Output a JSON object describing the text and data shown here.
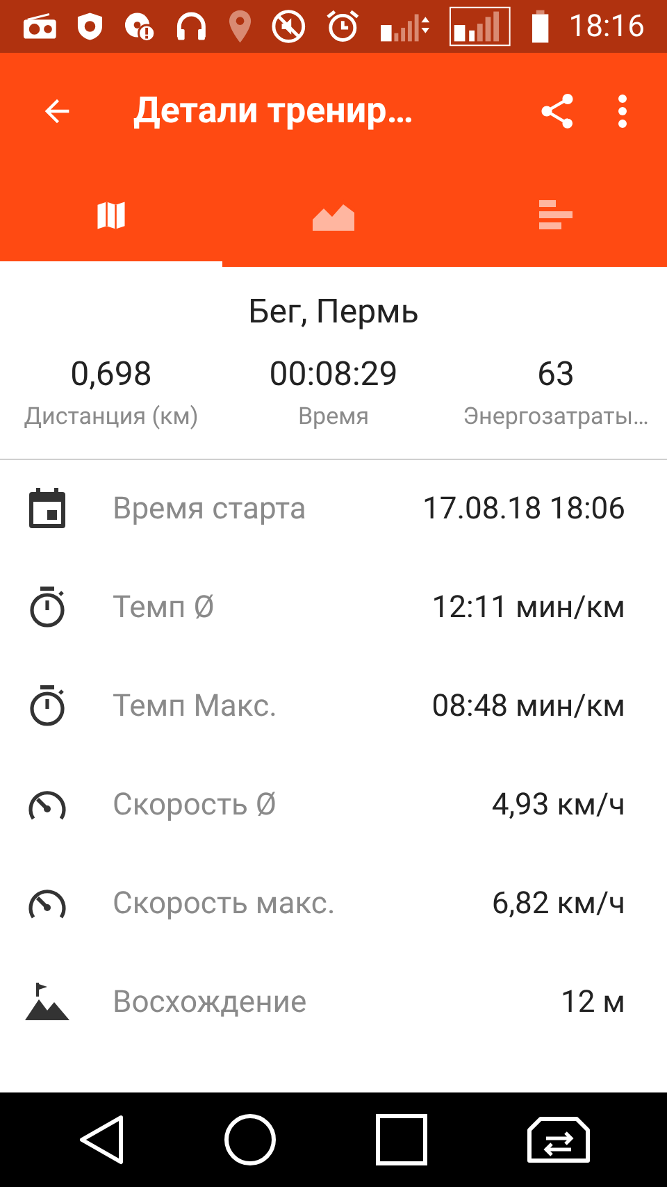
{
  "status_bar": {
    "time": "18:16"
  },
  "toolbar": {
    "title": "Детали тренир…"
  },
  "tabs": [
    {
      "kind": "map",
      "selected": true
    },
    {
      "kind": "chart",
      "selected": false
    },
    {
      "kind": "bars",
      "selected": false
    }
  ],
  "summary": {
    "title": "Бег, Пермь",
    "stats": [
      {
        "value": "0,698",
        "label": "Дистанция (км)"
      },
      {
        "value": "00:08:29",
        "label": "Время"
      },
      {
        "value": "63",
        "label": "Энергозатраты…"
      }
    ]
  },
  "details": [
    {
      "kind": "calendar",
      "label": "Время старта",
      "value": "17.08.18 18:06"
    },
    {
      "kind": "stopwatch",
      "label": "Темп Ø",
      "value": "12:11 мин/км"
    },
    {
      "kind": "stopwatch",
      "label": "Темп Макс.",
      "value": "08:48 мин/км"
    },
    {
      "kind": "speed",
      "label": "Скорость Ø",
      "value": "4,93 км/ч"
    },
    {
      "kind": "speed",
      "label": "Скорость макс.",
      "value": "6,82 км/ч"
    },
    {
      "kind": "mountain",
      "label": "Восхождение",
      "value": "12 м"
    }
  ]
}
